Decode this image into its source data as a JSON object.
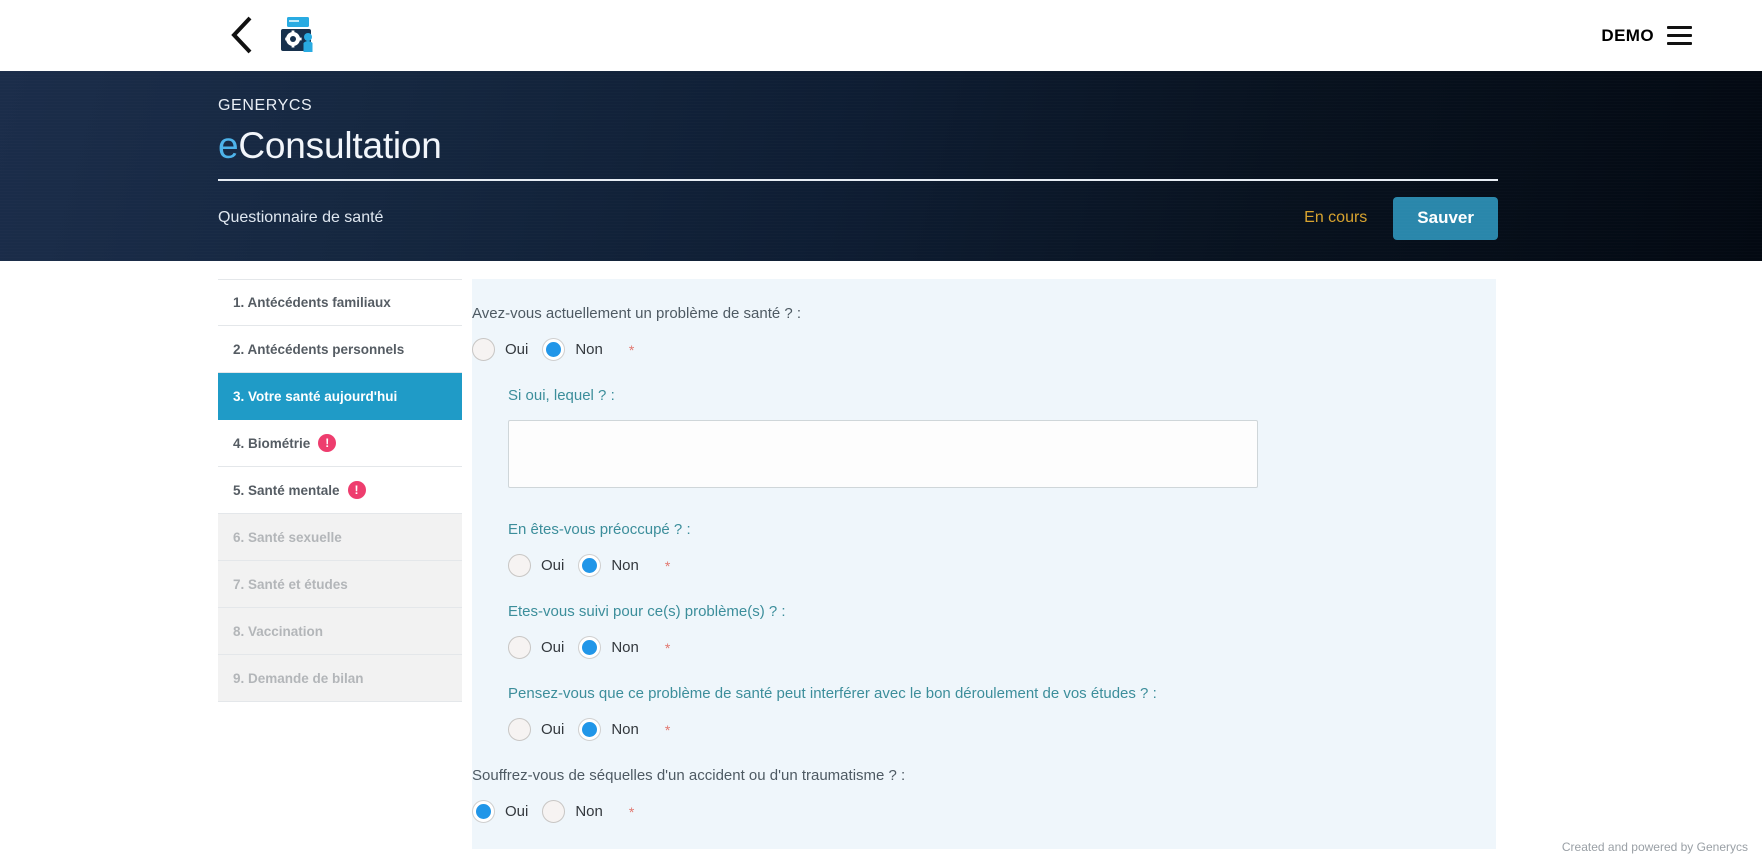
{
  "topbar": {
    "back_icon": "chevron-left-icon",
    "logo_icon": "clinic-logo-icon",
    "account_label": "DEMO",
    "menu_icon": "hamburger-menu-icon"
  },
  "banner": {
    "brand_small": "GENERYCS",
    "brand_accent": "e",
    "brand_rest": "Consultation",
    "subtitle": "Questionnaire de santé",
    "status": "En cours",
    "save_label": "Sauver",
    "status_color": "#d7a22e",
    "save_bg": "#2a87ab"
  },
  "sidebar": {
    "items": [
      {
        "label": "1. Antécédents familiaux",
        "state": "normal",
        "badge": ""
      },
      {
        "label": "2. Antécédents personnels",
        "state": "normal",
        "badge": ""
      },
      {
        "label": "3. Votre santé aujourd'hui",
        "state": "active",
        "badge": ""
      },
      {
        "label": "4. Biométrie",
        "state": "normal",
        "badge": "!"
      },
      {
        "label": "5. Santé mentale",
        "state": "normal",
        "badge": "!"
      },
      {
        "label": "6. Santé sexuelle",
        "state": "disabled",
        "badge": ""
      },
      {
        "label": "7. Santé et études",
        "state": "disabled",
        "badge": ""
      },
      {
        "label": "8. Vaccination",
        "state": "disabled",
        "badge": ""
      },
      {
        "label": "9. Demande de bilan",
        "state": "disabled",
        "badge": ""
      }
    ],
    "active_bg": "#1f9bc7",
    "badge_bg": "#ee3d6e"
  },
  "form": {
    "yes_label": "Oui",
    "no_label": "Non",
    "required_mark": "*",
    "questions": [
      {
        "text": "Avez-vous actuellement un problème de santé ? :",
        "selected": "Non",
        "style": "main"
      },
      {
        "text": "Si oui, lequel ? :",
        "style": "sub",
        "input_type": "textarea",
        "value": "",
        "placeholder": ""
      },
      {
        "text": "En êtes-vous préoccupé ? :",
        "selected": "Non",
        "style": "sub"
      },
      {
        "text": "Etes-vous suivi pour ce(s) problème(s) ? :",
        "selected": "Non",
        "style": "sub"
      },
      {
        "text": "Pensez-vous que ce problème de santé peut interférer avec le bon déroulement de vos études ? :",
        "selected": "Non",
        "style": "sub"
      },
      {
        "text": "Souffrez-vous de séquelles d'un accident ou d'un traumatisme ? :",
        "selected": "Oui",
        "style": "main"
      }
    ]
  },
  "footer": {
    "credit": "Created and powered by Generycs"
  }
}
